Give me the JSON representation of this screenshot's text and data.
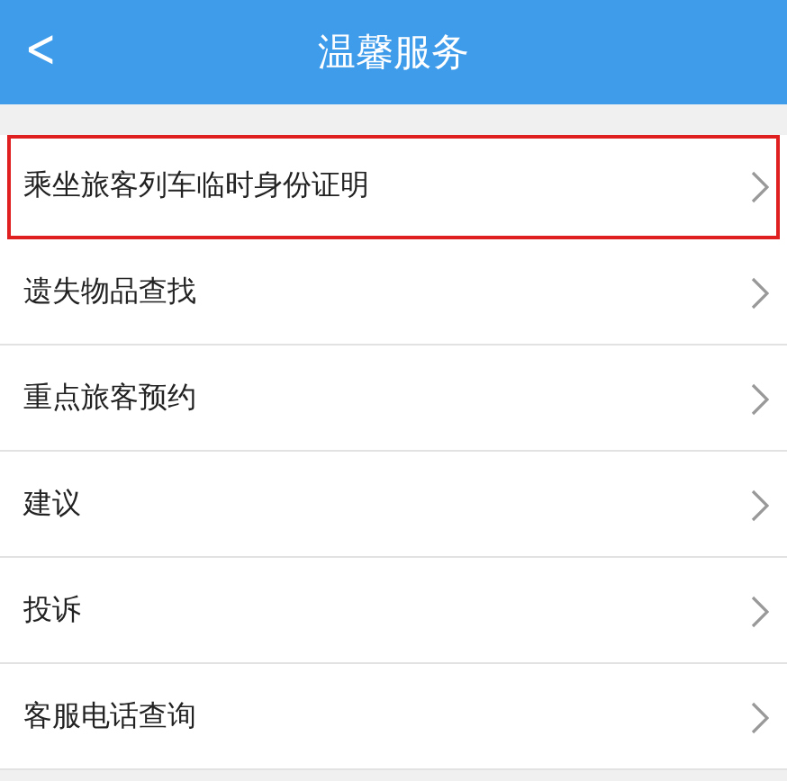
{
  "header": {
    "back": "<",
    "title": "温馨服务"
  },
  "items": [
    {
      "label": "乘坐旅客列车临时身份证明",
      "highlighted": true
    },
    {
      "label": "遗失物品查找",
      "highlighted": false
    },
    {
      "label": "重点旅客预约",
      "highlighted": false
    },
    {
      "label": "建议",
      "highlighted": false
    },
    {
      "label": "投诉",
      "highlighted": false
    },
    {
      "label": "客服电话查询",
      "highlighted": false
    }
  ]
}
